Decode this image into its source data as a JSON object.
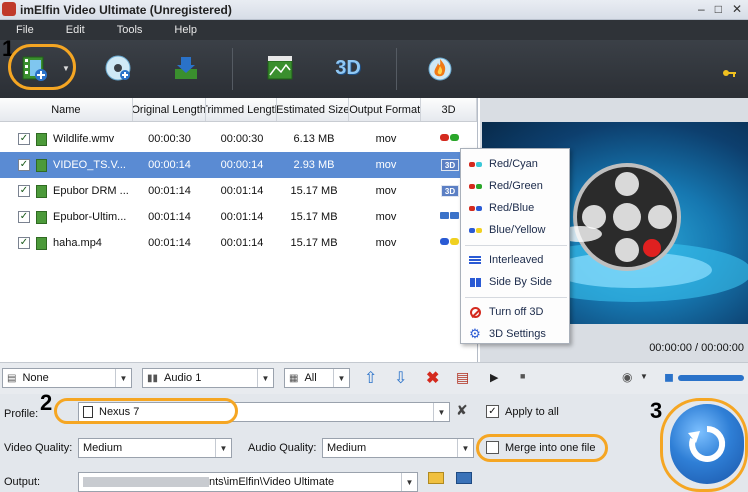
{
  "window": {
    "title": "imElfin Video Ultimate (Unregistered)"
  },
  "menu": [
    "File",
    "Edit",
    "Tools",
    "Help"
  ],
  "annotations": [
    "1",
    "2",
    "3"
  ],
  "table": {
    "headers": [
      "Name",
      "Original Length",
      "Trimmed Length",
      "Estimated Size",
      "Output Format",
      "3D"
    ],
    "rows": [
      {
        "name": "Wildlife.wmv",
        "original": "00:00:30",
        "trimmed": "00:00:30",
        "size": "6.13 MB",
        "format": "mov",
        "effect": "glasses-red-green",
        "selected": false
      },
      {
        "name": "VIDEO_TS.V...",
        "original": "00:00:14",
        "trimmed": "00:00:14",
        "size": "2.93 MB",
        "format": "mov",
        "effect": "3d-badge",
        "selected": true
      },
      {
        "name": "Epubor DRM ...",
        "original": "00:01:14",
        "trimmed": "00:01:14",
        "size": "15.17 MB",
        "format": "mov",
        "effect": "3d-badge",
        "selected": false
      },
      {
        "name": "Epubor-Ultim...",
        "original": "00:01:14",
        "trimmed": "00:01:14",
        "size": "15.17 MB",
        "format": "mov",
        "effect": "side-by-side",
        "selected": false
      },
      {
        "name": "haha.mp4",
        "original": "00:01:14",
        "trimmed": "00:01:14",
        "size": "15.17 MB",
        "format": "mov",
        "effect": "glasses-blue-yellow",
        "selected": false
      }
    ]
  },
  "context_menu": {
    "items": [
      {
        "label": "Red/Cyan",
        "icon": "glasses-red-cyan-icon"
      },
      {
        "label": "Red/Green",
        "icon": "glasses-red-green-icon"
      },
      {
        "label": "Red/Blue",
        "icon": "glasses-red-blue-icon"
      },
      {
        "label": "Blue/Yellow",
        "icon": "glasses-blue-yellow-icon"
      },
      {
        "label": "Interleaved",
        "icon": "interleaved-icon"
      },
      {
        "label": "Side By Side",
        "icon": "side-by-side-icon"
      },
      {
        "label": "Turn off 3D",
        "icon": "turn-off-icon"
      },
      {
        "label": "3D Settings",
        "icon": "settings-icon"
      }
    ]
  },
  "preview": {
    "time": "00:00:00 / 00:00:00"
  },
  "bottom": {
    "subtitle": "None",
    "audio_track": "Audio 1",
    "apply_filter": "All"
  },
  "settings": {
    "profile_label": "Profile:",
    "profile_value": "Nexus 7",
    "apply_to_all": "Apply to all",
    "video_quality_label": "Video Quality:",
    "video_quality": "Medium",
    "audio_quality_label": "Audio Quality:",
    "audio_quality": "Medium",
    "merge_label": "Merge into one file",
    "output_label": "Output:",
    "output_path": "nts\\imElfin\\Video Ultimate"
  },
  "colors": {
    "accent": "#5a8bd3",
    "annotation": "#f5a623"
  }
}
